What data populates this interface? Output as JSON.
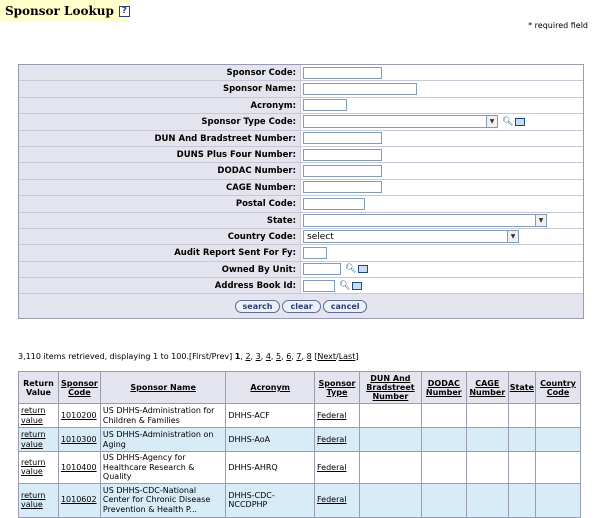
{
  "page": {
    "title": "Sponsor Lookup",
    "help_icon": "?",
    "required_note": "* required field"
  },
  "form": {
    "fields": [
      {
        "label": "Sponsor Code:",
        "type": "text",
        "value": ""
      },
      {
        "label": "Sponsor Name:",
        "type": "text",
        "value": ""
      },
      {
        "label": "Acronym:",
        "type": "text",
        "value": ""
      },
      {
        "label": "Sponsor Type Code:",
        "type": "select",
        "value": "",
        "icons": [
          "search-icon",
          "book-icon"
        ]
      },
      {
        "label": "DUN And Bradstreet Number:",
        "type": "text",
        "value": ""
      },
      {
        "label": "DUNS Plus Four Number:",
        "type": "text",
        "value": ""
      },
      {
        "label": "DODAC Number:",
        "type": "text",
        "value": ""
      },
      {
        "label": "CAGE Number:",
        "type": "text",
        "value": ""
      },
      {
        "label": "Postal Code:",
        "type": "text",
        "value": ""
      },
      {
        "label": "State:",
        "type": "select",
        "value": ""
      },
      {
        "label": "Country Code:",
        "type": "select",
        "value": "select"
      },
      {
        "label": "Audit Report Sent For Fy:",
        "type": "text",
        "value": ""
      },
      {
        "label": "Owned By Unit:",
        "type": "text",
        "value": "",
        "icons": [
          "search-icon",
          "book-icon"
        ]
      },
      {
        "label": "Address Book Id:",
        "type": "text",
        "value": "",
        "icons": [
          "search-icon",
          "book-icon"
        ]
      }
    ],
    "buttons": {
      "search": "search",
      "clear": "clear",
      "cancel": "cancel"
    }
  },
  "pager": {
    "summary": "3,110 items retrieved, displaying 1 to 100.",
    "first_prev": "[First/Prev]",
    "current": "1",
    "pages": [
      "2",
      "3",
      "4",
      "5",
      "6",
      "7",
      "8"
    ],
    "next_last_open": "[",
    "next": "Next",
    "sep": "/",
    "last": "Last",
    "next_last_close": "]"
  },
  "table": {
    "headers": [
      "Return Value",
      "Sponsor Code",
      "Sponsor Name",
      "Acronym",
      "Sponsor Type",
      "DUN And Bradstreet Number",
      "DODAC Number",
      "CAGE Number",
      "State",
      "Country Code"
    ],
    "rows": [
      {
        "return": "return value",
        "code": "1010200",
        "name": "US DHHS-Administration for Children & Families",
        "acronym": "DHHS-ACF",
        "type": "Federal",
        "dun": "",
        "dodac": "",
        "cage": "",
        "state": "",
        "country": ""
      },
      {
        "return": "return value",
        "code": "1010300",
        "name": "US DHHS-Administration on Aging",
        "acronym": "DHHS-AoA",
        "type": "Federal",
        "dun": "",
        "dodac": "",
        "cage": "",
        "state": "",
        "country": ""
      },
      {
        "return": "return value",
        "code": "1010400",
        "name": "US DHHS-Agency for Healthcare Research & Quality",
        "acronym": "DHHS-AHRQ",
        "type": "Federal",
        "dun": "",
        "dodac": "",
        "cage": "",
        "state": "",
        "country": ""
      },
      {
        "return": "return value",
        "code": "1010602",
        "name": "US DHHS-CDC-National Center for Chronic Disease Prevention & Health P...",
        "acronym": "DHHS-CDC-NCCDPHP",
        "type": "Federal",
        "dun": "",
        "dodac": "",
        "cage": "",
        "state": "",
        "country": ""
      }
    ]
  },
  "colors": {
    "title_bg": "#ffffcc",
    "label_bg": "#e4e4ee",
    "alt_row_bg": "#d8ecf8",
    "border": "#9a9ab0"
  }
}
